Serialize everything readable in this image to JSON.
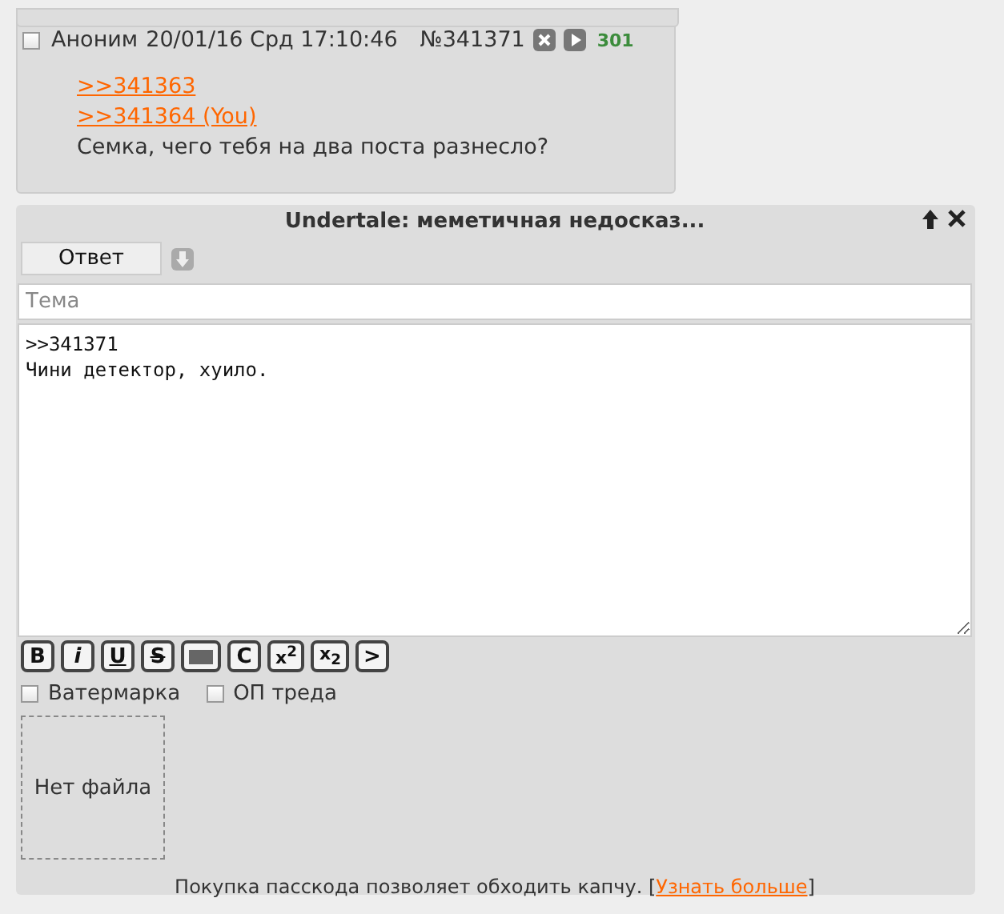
{
  "post": {
    "checked": false,
    "author": "Аноним",
    "date": "20/01/16 Срд 17:10:46",
    "number": "№341371",
    "reply_count": "301",
    "links": [
      ">>341363",
      ">>341364 (You)"
    ],
    "text": "Семка, чего тебя на два поста разнесло?"
  },
  "reply_form": {
    "title": "Undertale: меметичная недосказ...",
    "tab_button": "Ответ",
    "subject_placeholder": "Тема",
    "message": ">>341371\nЧини детектор, хуило.",
    "format_buttons": [
      {
        "kind": "bold",
        "label": "B"
      },
      {
        "kind": "italic",
        "label": "i"
      },
      {
        "kind": "underline",
        "label": "U"
      },
      {
        "kind": "strike",
        "label": "S"
      },
      {
        "kind": "spoiler"
      },
      {
        "kind": "code",
        "label": "C"
      },
      {
        "kind": "sup",
        "label": "x$^{2}$"
      },
      {
        "kind": "sub",
        "label": "x$_{2}$"
      },
      {
        "kind": "quote",
        "label": ">"
      }
    ],
    "options": [
      {
        "label": "Ватермарка",
        "checked": false
      },
      {
        "label": "ОП треда",
        "checked": false
      }
    ],
    "file_placeholder": "Нет файла",
    "notice": {
      "text": "Покупка пасскода позволяет обходить капчу. [",
      "link": "Узнать больше",
      "text_after": "]"
    }
  }
}
